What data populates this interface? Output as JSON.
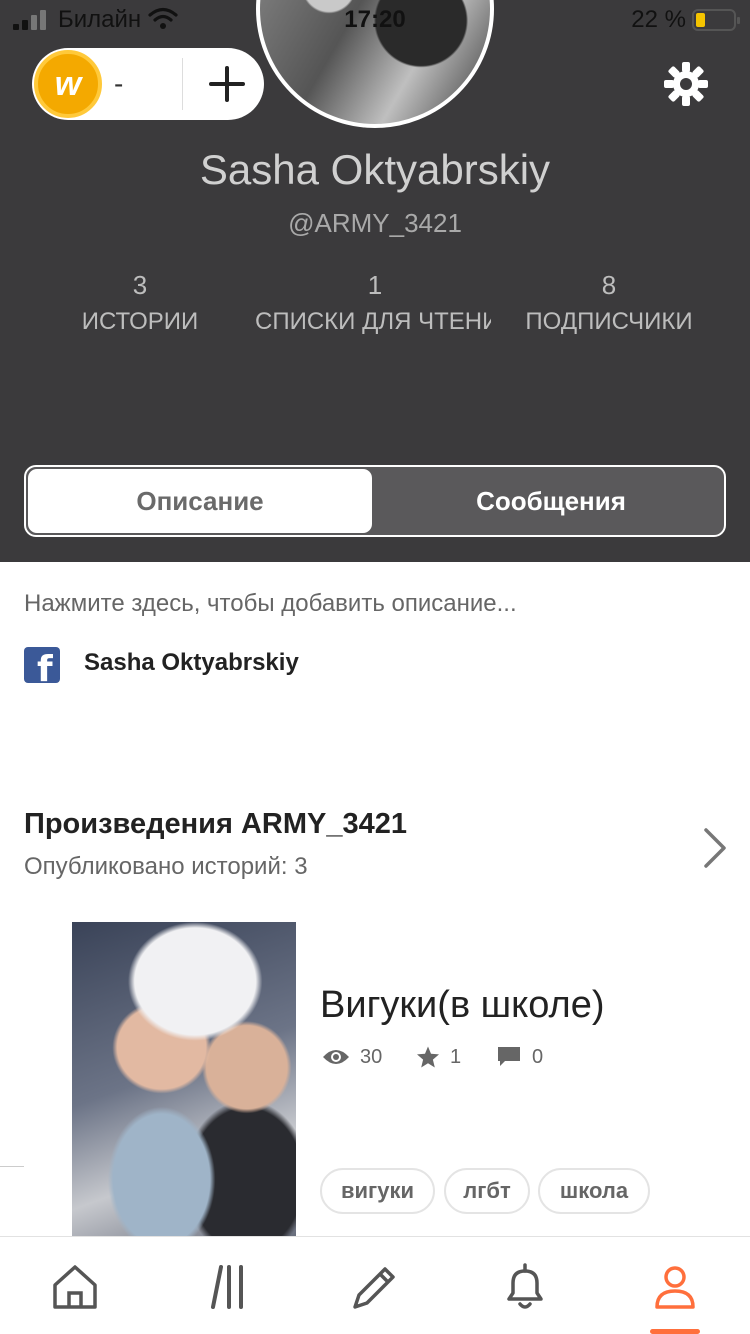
{
  "status_bar": {
    "carrier": "Билайн",
    "time": "17:20",
    "battery_percent": "22 %",
    "battery_color": "#f5c400"
  },
  "coins": {
    "count": "-",
    "coin_glyph": "w",
    "add_icon": "plus-icon"
  },
  "settings_icon": "gear-icon",
  "profile": {
    "name": "Sasha Oktyabrskiy",
    "handle": "@ARMY_3421"
  },
  "stats": [
    {
      "value": "3",
      "label": "ИСТОРИИ"
    },
    {
      "value": "1",
      "label": "СПИСКИ ДЛЯ ЧТЕНИЯ"
    },
    {
      "value": "8",
      "label": "ПОДПИСЧИКИ"
    }
  ],
  "segmented": {
    "about": "Описание",
    "messages": "Сообщения",
    "selected": "about"
  },
  "about": {
    "description_hint": "Нажмите здесь, чтобы добавить описание...",
    "facebook_name": "Sasha Oktyabrskiy",
    "facebook_icon": "facebook-icon"
  },
  "works": {
    "title_prefix": "Произведения",
    "title_user": "ARMY_3421",
    "subtitle": "Опубликовано историй: 3"
  },
  "story": {
    "title": "Вигуки(в школе)",
    "reads": "30",
    "votes": "1",
    "comments": "0",
    "tags": [
      "вигуки",
      "лгбт",
      "школа"
    ]
  },
  "tabbar": {
    "items": [
      "home-icon",
      "library-icon",
      "write-icon",
      "notifications-icon",
      "profile-icon"
    ],
    "active": "profile-icon",
    "accent": "#ff6f3c"
  },
  "colors": {
    "header_bg": "#3b3a3c",
    "facebook_blue": "#3b5998",
    "coin_gold": "#f4a900"
  }
}
